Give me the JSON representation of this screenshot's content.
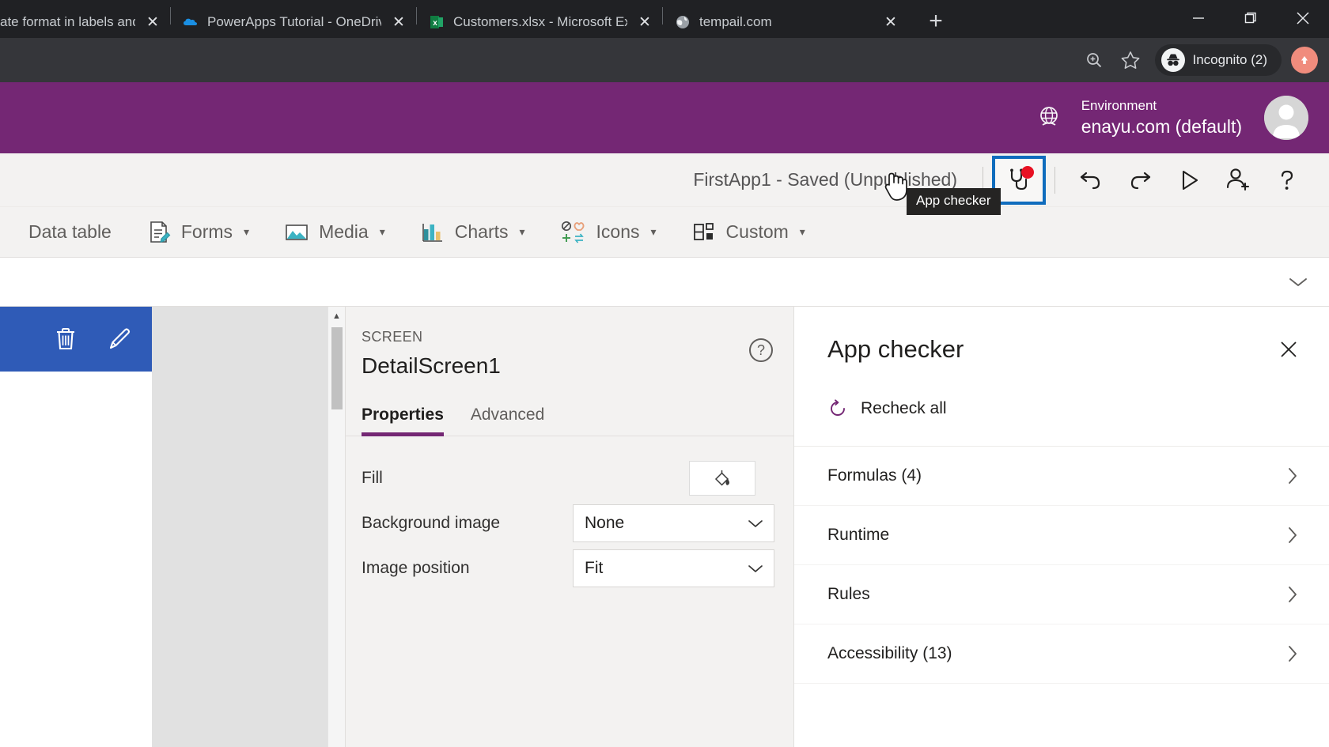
{
  "browser": {
    "tabs": [
      {
        "title": "ate format in labels and",
        "favicon": "none-icon",
        "close_label": "✕"
      },
      {
        "title": "PowerApps Tutorial - OneDrive",
        "favicon": "onedrive-icon",
        "close_label": "✕"
      },
      {
        "title": "Customers.xlsx - Microsoft Excel O",
        "favicon": "excel-icon",
        "close_label": "✕"
      },
      {
        "title": "tempail.com",
        "favicon": "globe-icon",
        "close_label": "✕"
      }
    ],
    "new_tab_label": "+",
    "window_controls": {
      "minimize": "—",
      "maximize": "❐",
      "close": "✕"
    },
    "toolbar": {
      "zoom_icon": "zoom-in-icon",
      "bookmark_icon": "star-icon",
      "incognito_label": "Incognito (2)",
      "incognito_icon": "incognito-icon",
      "profile_icon": "profile-avatar-icon"
    },
    "colors": {
      "tabstrip_bg": "#202124",
      "toolbar_bg": "#35363a"
    }
  },
  "environment": {
    "label": "Environment",
    "value": "enayu.com (default)",
    "globe_icon": "globe-icon",
    "avatar_icon": "user-avatar-icon",
    "bar_color": "#742774"
  },
  "command_bar": {
    "app_title": "FirstApp1 - Saved (Unpublished)",
    "app_checker": {
      "icon": "stethoscope-icon",
      "tooltip": "App checker",
      "has_badge": true,
      "badge_color": "#e81123",
      "focus_color": "#0f6cbd"
    },
    "buttons": [
      {
        "name": "undo",
        "icon": "undo-arrow-icon"
      },
      {
        "name": "redo",
        "icon": "redo-arrow-icon"
      },
      {
        "name": "preview",
        "icon": "play-triangle-icon"
      },
      {
        "name": "share",
        "icon": "person-add-icon"
      },
      {
        "name": "help",
        "icon": "question-mark-icon"
      }
    ]
  },
  "ribbon": {
    "items": [
      {
        "label": "Data table",
        "icon": null,
        "has_caret": false
      },
      {
        "label": "Forms",
        "icon": "form-edit-icon",
        "has_caret": true
      },
      {
        "label": "Media",
        "icon": "image-icon",
        "has_caret": true
      },
      {
        "label": "Charts",
        "icon": "bar-chart-icon",
        "has_caret": true
      },
      {
        "label": "Icons",
        "icon": "icons-group-icon",
        "has_caret": true
      },
      {
        "label": "Custom",
        "icon": "custom-blocks-icon",
        "has_caret": true
      }
    ]
  },
  "formula_bar": {
    "value": "",
    "expand_icon": "chevron-down-icon"
  },
  "canvas": {
    "screen_header": {
      "delete_icon": "trash-icon",
      "edit_icon": "pencil-icon",
      "color": "#2f5bb7"
    }
  },
  "properties": {
    "kind": "SCREEN",
    "name": "DetailScreen1",
    "help_icon": "question-circle-icon",
    "tabs": [
      {
        "label": "Properties",
        "active": true
      },
      {
        "label": "Advanced",
        "active": false
      }
    ],
    "accent_color": "#742774",
    "rows": [
      {
        "label": "Fill",
        "type": "color",
        "icon": "paint-bucket-icon"
      },
      {
        "label": "Background image",
        "type": "select",
        "value": "None"
      },
      {
        "label": "Image position",
        "type": "select",
        "value": "Fit"
      }
    ]
  },
  "app_checker": {
    "title": "App checker",
    "close_label": "✕",
    "recheck_label": "Recheck all",
    "recheck_icon": "refresh-icon",
    "items": [
      {
        "label": "Formulas (4)",
        "chevron": "›"
      },
      {
        "label": "Runtime",
        "chevron": "›"
      },
      {
        "label": "Rules",
        "chevron": "›"
      },
      {
        "label": "Accessibility (13)",
        "chevron": "›"
      }
    ]
  }
}
